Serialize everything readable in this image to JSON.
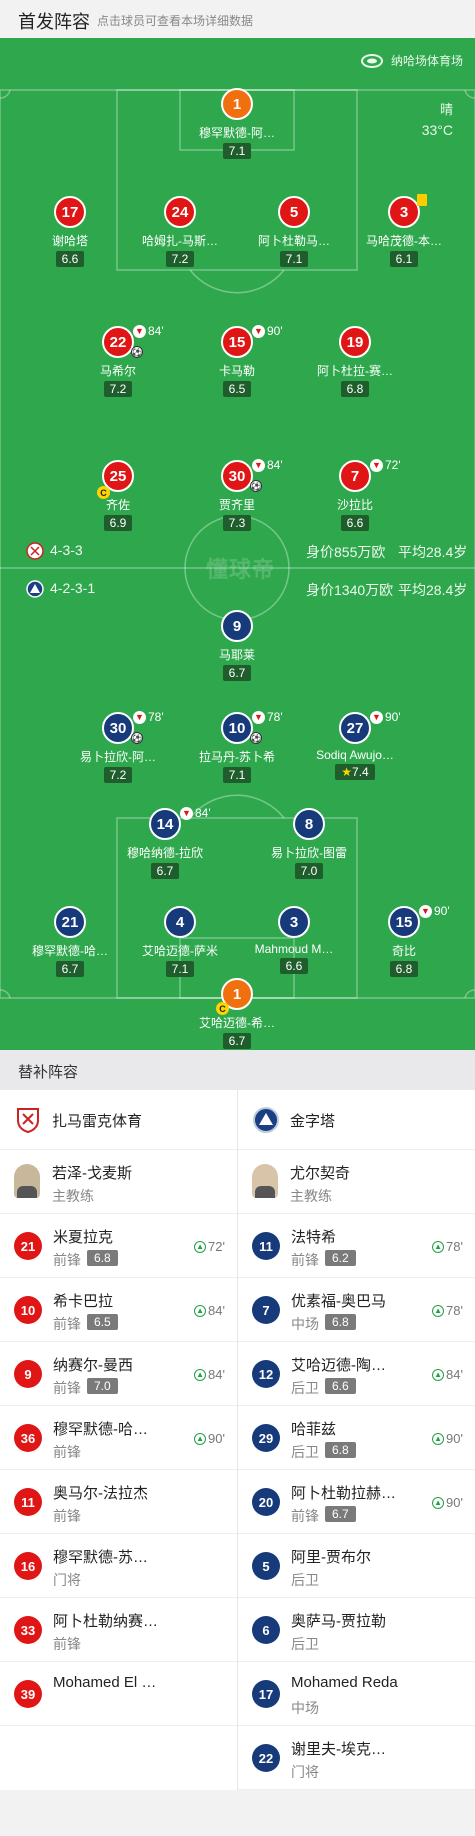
{
  "header": {
    "title": "首发阵容",
    "subtitle": "点击球员可查看本场详细数据"
  },
  "venue": {
    "name": "纳哈场体育场",
    "weather": "晴",
    "temperature": "33°C"
  },
  "watermark": "懂球帝",
  "home_team": {
    "formation": "4-3-3",
    "value": "身价855万欧",
    "avg_age": "平均28.4岁",
    "color": "#e01515"
  },
  "away_team": {
    "formation": "4-2-3-1",
    "value": "身价1340万欧",
    "avg_age": "平均28.4岁",
    "color": "#173a7a"
  },
  "home_players": [
    {
      "num": "1",
      "name": "穆罕默德-阿…",
      "rating": "7.1"
    },
    {
      "num": "17",
      "name": "谢哈塔",
      "rating": "6.6"
    },
    {
      "num": "24",
      "name": "哈姆扎-马斯…",
      "rating": "7.2"
    },
    {
      "num": "5",
      "name": "阿卜杜勒马…",
      "rating": "7.1"
    },
    {
      "num": "3",
      "name": "马哈茂德-本…",
      "rating": "6.1"
    },
    {
      "num": "22",
      "name": "马希尔",
      "rating": "7.2",
      "sub": "84'"
    },
    {
      "num": "15",
      "name": "卡马勒",
      "rating": "6.5",
      "sub": "90'"
    },
    {
      "num": "19",
      "name": "阿卜杜拉-赛…",
      "rating": "6.8"
    },
    {
      "num": "25",
      "name": "齐佐",
      "rating": "6.9"
    },
    {
      "num": "30",
      "name": "贾齐里",
      "rating": "7.3",
      "sub": "84'"
    },
    {
      "num": "7",
      "name": "沙拉比",
      "rating": "6.6",
      "sub": "72'"
    }
  ],
  "away_players": [
    {
      "num": "9",
      "name": "马耶莱",
      "rating": "6.7"
    },
    {
      "num": "30",
      "name": "易卜拉欣-阿…",
      "rating": "7.2",
      "sub": "78'"
    },
    {
      "num": "10",
      "name": "拉马丹-苏卜希",
      "rating": "7.1",
      "sub": "78'"
    },
    {
      "num": "27",
      "name": "Sodiq Awujo…",
      "rating": "7.4",
      "sub": "90'"
    },
    {
      "num": "14",
      "name": "穆哈纳德-拉欣",
      "rating": "6.7",
      "sub": "84'"
    },
    {
      "num": "8",
      "name": "易卜拉欣-图雷",
      "rating": "7.0"
    },
    {
      "num": "21",
      "name": "穆罕默德-哈…",
      "rating": "6.7"
    },
    {
      "num": "4",
      "name": "艾哈迈德-萨米",
      "rating": "7.1"
    },
    {
      "num": "3",
      "name": "Mahmoud M…",
      "rating": "6.6"
    },
    {
      "num": "15",
      "name": "奇比",
      "rating": "6.8",
      "sub": "90'"
    },
    {
      "num": "1",
      "name": "艾哈迈德-希…",
      "rating": "6.7"
    }
  ],
  "subs": {
    "title": "替补阵容",
    "left": {
      "team": "扎马雷克体育",
      "coach": {
        "name": "若泽-戈麦斯",
        "role": "主教练"
      },
      "players": [
        {
          "num": "21",
          "name": "米夏拉克",
          "pos": "前锋",
          "rating": "6.8",
          "min": "72'"
        },
        {
          "num": "10",
          "name": "希卡巴拉",
          "pos": "前锋",
          "rating": "6.5",
          "min": "84'"
        },
        {
          "num": "9",
          "name": "纳赛尔-曼西",
          "pos": "前锋",
          "rating": "7.0",
          "min": "84'"
        },
        {
          "num": "36",
          "name": "穆罕默德-哈…",
          "pos": "前锋",
          "rating": "",
          "min": "90'"
        },
        {
          "num": "11",
          "name": "奥马尔-法拉杰",
          "pos": "前锋",
          "rating": "",
          "min": ""
        },
        {
          "num": "16",
          "name": "穆罕默德-苏…",
          "pos": "门将",
          "rating": "",
          "min": ""
        },
        {
          "num": "33",
          "name": "阿卜杜勒纳赛…",
          "pos": "前锋",
          "rating": "",
          "min": ""
        },
        {
          "num": "39",
          "name": "Mohamed El …",
          "pos": "",
          "rating": "",
          "min": ""
        }
      ]
    },
    "right": {
      "team": "金字塔",
      "coach": {
        "name": "尤尔契奇",
        "role": "主教练"
      },
      "players": [
        {
          "num": "11",
          "name": "法特希",
          "pos": "前锋",
          "rating": "6.2",
          "min": "78'"
        },
        {
          "num": "7",
          "name": "优素福-奥巴马",
          "pos": "中场",
          "rating": "6.8",
          "min": "78'"
        },
        {
          "num": "12",
          "name": "艾哈迈德-陶…",
          "pos": "后卫",
          "rating": "6.6",
          "min": "84'"
        },
        {
          "num": "29",
          "name": "哈菲兹",
          "pos": "后卫",
          "rating": "6.8",
          "min": "90'"
        },
        {
          "num": "20",
          "name": "阿卜杜勒拉赫…",
          "pos": "前锋",
          "rating": "6.7",
          "min": "90'"
        },
        {
          "num": "5",
          "name": "阿里-贾布尔",
          "pos": "后卫",
          "rating": "",
          "min": ""
        },
        {
          "num": "6",
          "name": "奥萨马-贾拉勒",
          "pos": "后卫",
          "rating": "",
          "min": ""
        },
        {
          "num": "17",
          "name": "Mohamed Reda",
          "pos": "中场",
          "rating": "",
          "min": ""
        },
        {
          "num": "22",
          "name": "谢里夫-埃克…",
          "pos": "门将",
          "rating": "",
          "min": ""
        }
      ]
    }
  }
}
